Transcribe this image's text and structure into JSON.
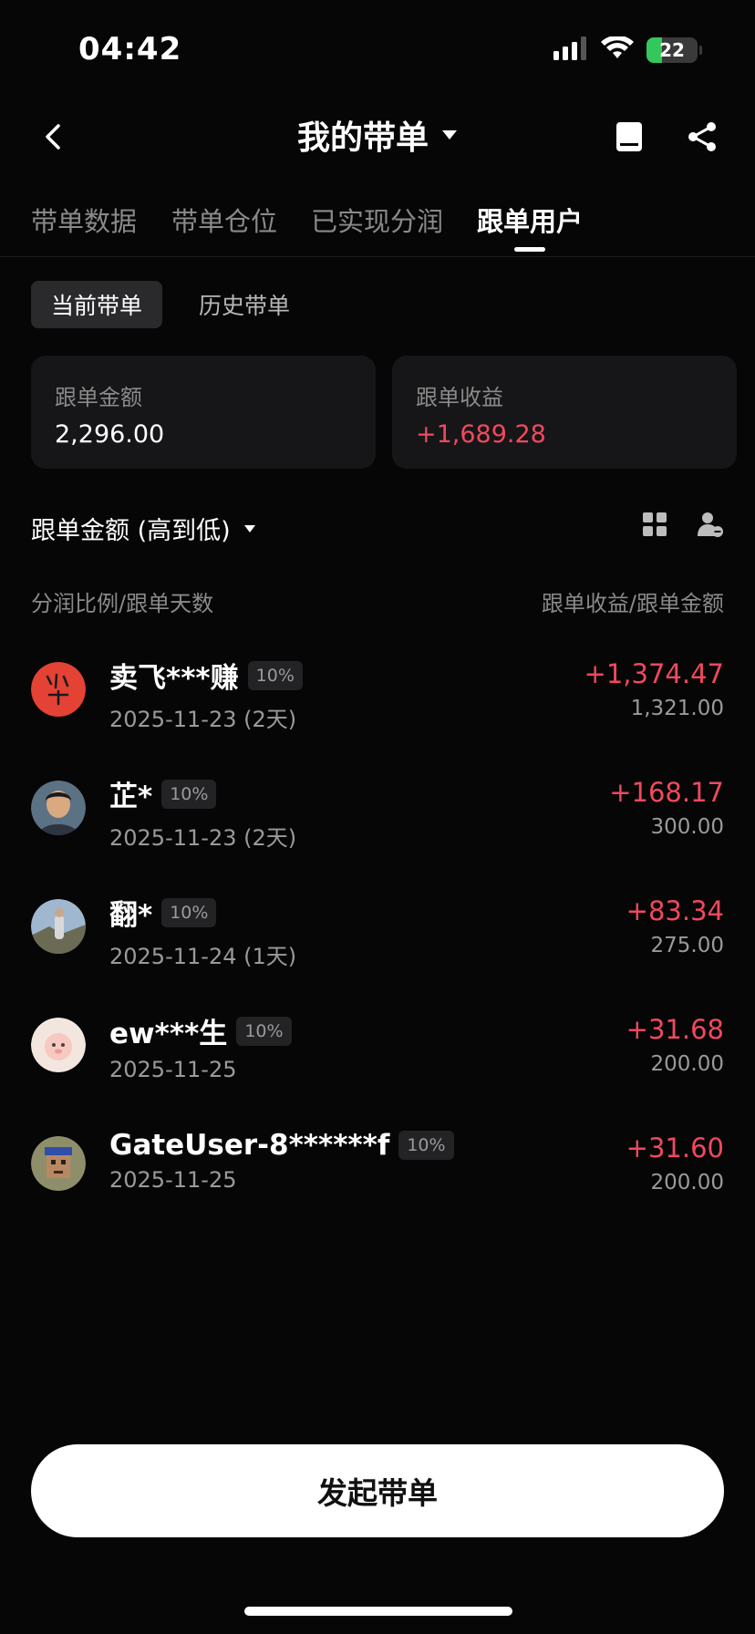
{
  "status_bar": {
    "time": "04:42",
    "battery_level": "22"
  },
  "nav": {
    "title": "我的带单"
  },
  "tabs": [
    {
      "label": "带单数据"
    },
    {
      "label": "带单仓位"
    },
    {
      "label": "已实现分润"
    },
    {
      "label": "跟单用户",
      "active": true
    }
  ],
  "subtabs": [
    {
      "label": "当前带单",
      "active": true
    },
    {
      "label": "历史带单"
    }
  ],
  "summary": {
    "amount_label": "跟单金额",
    "amount_value": "2,296.00",
    "profit_label": "跟单收益",
    "profit_value": "+1,689.28"
  },
  "sort": {
    "label": "跟单金额 (高到低)"
  },
  "columns": {
    "left": "分润比例/跟单天数",
    "right": "跟单收益/跟单金额"
  },
  "followers": [
    {
      "name": "卖飞***赚",
      "ratio": "10%",
      "date": "2025-11-23 (2天)",
      "profit": "+1,374.47",
      "amount": "1,321.00"
    },
    {
      "name": "芷*",
      "ratio": "10%",
      "date": "2025-11-23 (2天)",
      "profit": "+168.17",
      "amount": "300.00"
    },
    {
      "name": "翻*",
      "ratio": "10%",
      "date": "2025-11-24 (1天)",
      "profit": "+83.34",
      "amount": "275.00"
    },
    {
      "name": "ew***生",
      "ratio": "10%",
      "date": "2025-11-25",
      "profit": "+31.68",
      "amount": "200.00"
    },
    {
      "name": "GateUser-8******f",
      "ratio": "10%",
      "date": "2025-11-25",
      "profit": "+31.60",
      "amount": "200.00"
    }
  ],
  "primary_button": {
    "label": "发起带单"
  },
  "colors": {
    "background": "#060606",
    "card": "#161618",
    "positive": "#f0495e",
    "muted": "#8a8a8a",
    "battery": "#34c759"
  }
}
